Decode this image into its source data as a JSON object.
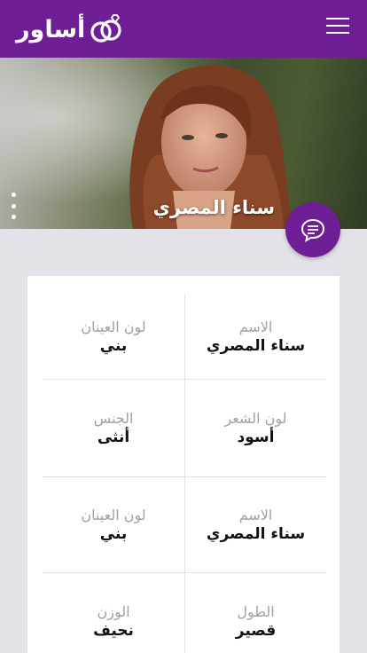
{
  "header": {
    "logo_text": "أساور",
    "menu_icon": "hamburger-menu-icon",
    "background_color": "#6e1f96"
  },
  "profile": {
    "name": "سناء المصري",
    "more_icon": "vertical-dots-icon",
    "chat_icon": "chat-bubble-icon"
  },
  "details": [
    {
      "right": {
        "label": "الاسم",
        "value": "سناء المصري"
      },
      "left": {
        "label": "لون العينان",
        "value": "بني"
      }
    },
    {
      "right": {
        "label": "لون الشعر",
        "value": "أسود"
      },
      "left": {
        "label": "الجنس",
        "value": "أنثى"
      }
    },
    {
      "right": {
        "label": "الاسم",
        "value": "سناء المصري"
      },
      "left": {
        "label": "لون العينان",
        "value": "بني"
      }
    },
    {
      "right": {
        "label": "الطول",
        "value": "قصير"
      },
      "left": {
        "label": "الوزن",
        "value": "نحيف"
      }
    }
  ]
}
